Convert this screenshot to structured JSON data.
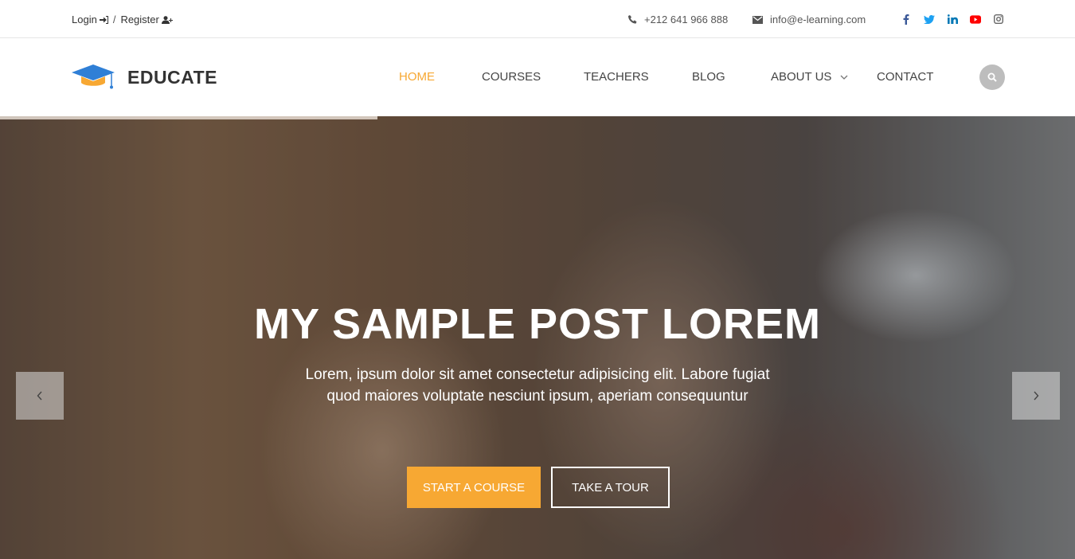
{
  "topbar": {
    "login": "Login",
    "separator": "/",
    "register": "Register",
    "phone": "+212 641 966 888",
    "email": "info@e-learning.com",
    "social": [
      "facebook-icon",
      "twitter-icon",
      "linkedin-icon",
      "youtube-icon",
      "instagram-icon"
    ]
  },
  "header": {
    "logo_text": "EDUCATE",
    "nav": [
      "HOME",
      "COURSES",
      "TEACHERS",
      "BLOG",
      "ABOUT US",
      "CONTACT"
    ],
    "active": "HOME"
  },
  "hero": {
    "title": "MY SAMPLE POST LOREM",
    "subtitle_line1": "Lorem, ipsum dolor sit amet consectetur adipisicing elit. Labore fugiat",
    "subtitle_line2": "quod maiores voluptate nesciunt ipsum, aperiam consequuntur",
    "primary_button": "START A COURSE",
    "secondary_button": "TAKE A TOUR"
  },
  "colors": {
    "accent": "#f7a833",
    "logo_blue": "#2f7fd6",
    "facebook": "#3b5998",
    "twitter": "#1da1f2",
    "linkedin": "#0077b5",
    "youtube": "#ff0000",
    "instagram": "#666666"
  }
}
